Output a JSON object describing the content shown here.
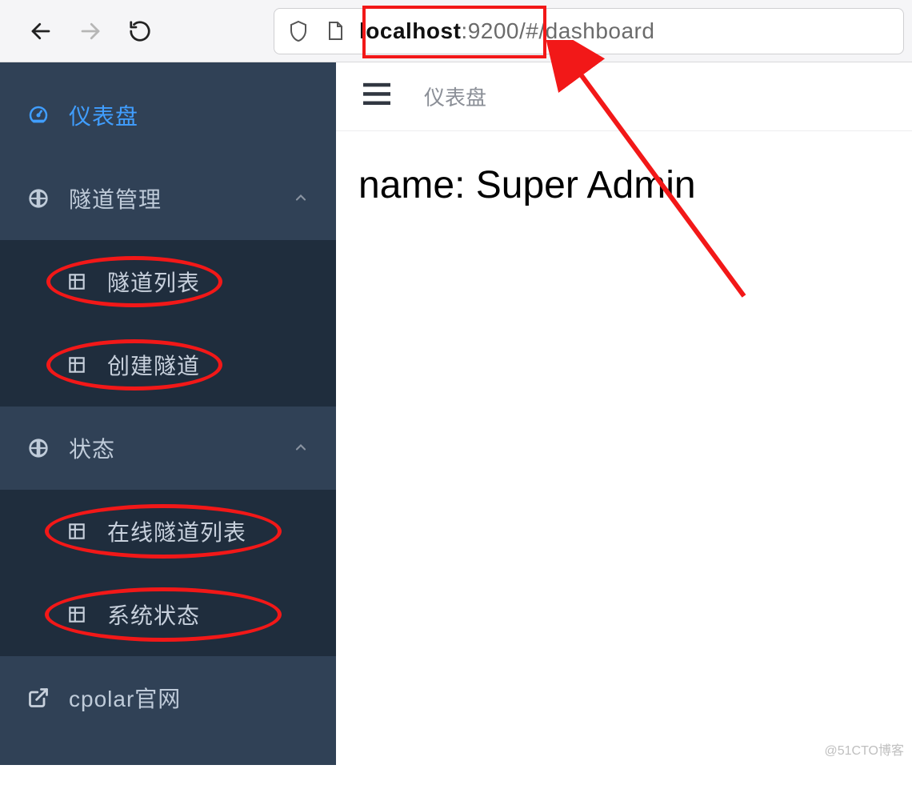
{
  "browser": {
    "url_host": "localhost",
    "url_path": ":9200/#/dashboard"
  },
  "sidebar": {
    "dashboard": {
      "label": "仪表盘"
    },
    "tunnel_mgmt": {
      "label": "隧道管理",
      "items": [
        {
          "label": "隧道列表"
        },
        {
          "label": "创建隧道"
        }
      ]
    },
    "status": {
      "label": "状态",
      "items": [
        {
          "label": "在线隧道列表"
        },
        {
          "label": "系统状态"
        }
      ]
    },
    "cpolar": {
      "label": "cpolar官网"
    }
  },
  "content": {
    "breadcrumb": "仪表盘",
    "main_text": "name: Super Admin"
  },
  "watermark": "@51CTO博客"
}
